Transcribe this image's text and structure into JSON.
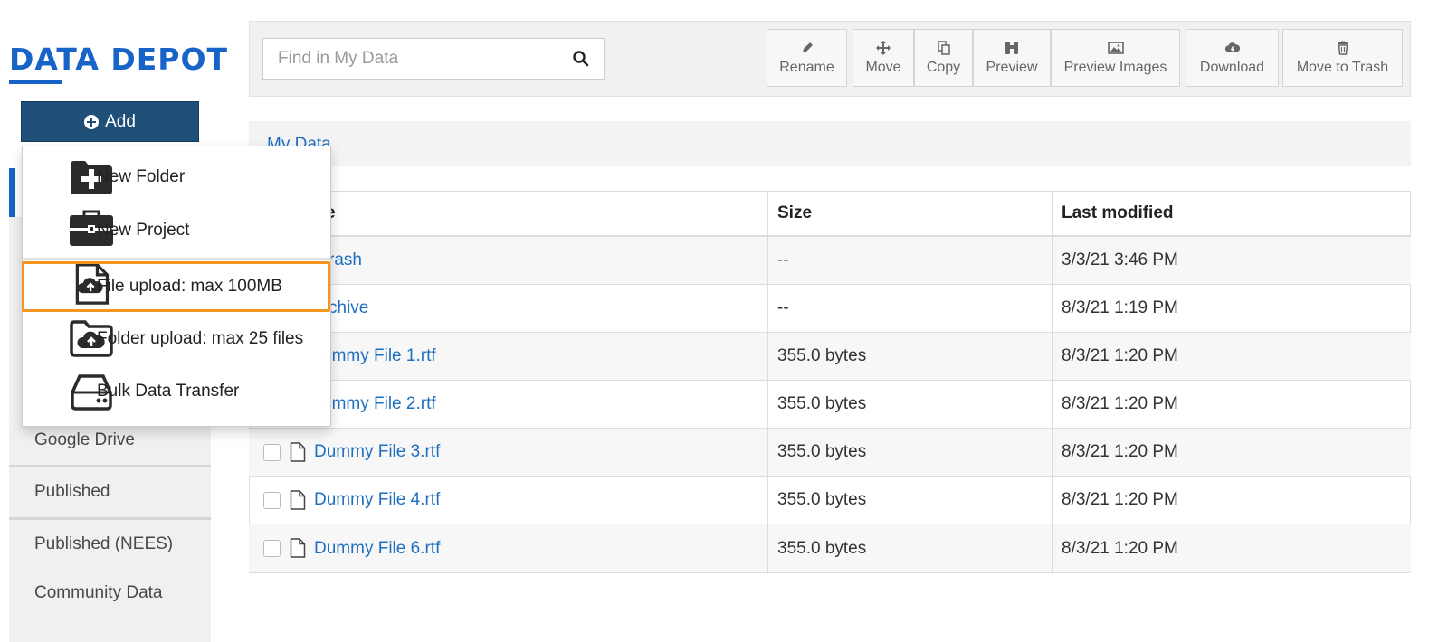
{
  "brand": {
    "title": "DATA DEPOT"
  },
  "add_button": {
    "label": "Add"
  },
  "add_menu": {
    "items": [
      {
        "label": "New Folder",
        "icon": "new-folder-icon"
      },
      {
        "label": "New Project",
        "icon": "briefcase-icon"
      },
      {
        "label": "File upload: max 100MB",
        "icon": "file-upload-icon",
        "highlighted": true
      },
      {
        "label": "Folder upload: max 25 files",
        "icon": "folder-upload-icon"
      },
      {
        "label": "Bulk Data Transfer",
        "icon": "hard-drive-icon"
      }
    ]
  },
  "sidebar": {
    "items": [
      {
        "label": "Google Drive"
      },
      {
        "label": "Published"
      },
      {
        "label": "Published (NEES)"
      },
      {
        "label": "Community Data"
      }
    ]
  },
  "search": {
    "placeholder": "Find in My Data",
    "icon": "search-icon"
  },
  "toolbar": {
    "buttons": [
      {
        "label": "Rename",
        "icon": "pencil-icon"
      },
      {
        "label": "Move",
        "icon": "move-arrows-icon"
      },
      {
        "label": "Copy",
        "icon": "copy-icon"
      },
      {
        "label": "Preview",
        "icon": "binoculars-icon"
      },
      {
        "label": "Preview Images",
        "icon": "image-icon"
      },
      {
        "label": "Download",
        "icon": "cloud-download-icon"
      },
      {
        "label": "Move to Trash",
        "icon": "trash-icon"
      }
    ]
  },
  "breadcrumb": {
    "label": "My Data"
  },
  "table": {
    "headers": {
      "name": "e",
      "size": "Size",
      "modified": "Last modified"
    },
    "rows": [
      {
        "name": "rash",
        "size": "--",
        "modified": "3/3/21 3:46 PM"
      },
      {
        "name": "chive",
        "size": "--",
        "modified": "8/3/21 1:19 PM"
      },
      {
        "name": "ummy File 1.rtf",
        "size": "355.0 bytes",
        "modified": "8/3/21 1:20 PM"
      },
      {
        "name": "ummy File 2.rtf",
        "size": "355.0 bytes",
        "modified": "8/3/21 1:20 PM"
      },
      {
        "name": "Dummy File 3.rtf",
        "size": "355.0 bytes",
        "modified": "8/3/21 1:20 PM"
      },
      {
        "name": "Dummy File 4.rtf",
        "size": "355.0 bytes",
        "modified": "8/3/21 1:20 PM"
      },
      {
        "name": "Dummy File 6.rtf",
        "size": "355.0 bytes",
        "modified": "8/3/21 1:20 PM"
      }
    ]
  },
  "colors": {
    "brand": "#1863c7",
    "add_button": "#1f4e79",
    "link": "#1f6fbf",
    "highlight": "#f5941e"
  }
}
